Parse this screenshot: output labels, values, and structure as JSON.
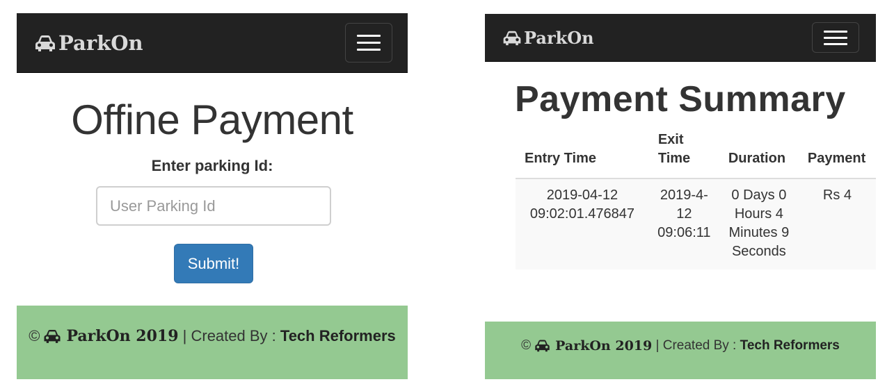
{
  "left": {
    "navbar": {
      "brand": "ParkOn"
    },
    "title": "Offine Payment",
    "form": {
      "label": "Enter parking Id:",
      "input_placeholder": "User Parking Id",
      "input_value": "",
      "submit_label": "Submit!"
    },
    "footer": {
      "copyright": "©",
      "brand": "ParkOn 2019",
      "separator": "| Created By :",
      "author": "Tech Reformers"
    }
  },
  "right": {
    "navbar": {
      "brand": "ParkOn"
    },
    "title": "Payment Summary",
    "table": {
      "headers": [
        "Entry Time",
        "Exit Time",
        "Duration",
        "Payment"
      ],
      "rows": [
        {
          "entry_time": "2019-04-12 09:02:01.476847",
          "exit_time": "2019-4-12 09:06:11",
          "duration": "0 Days 0 Hours 4 Minutes 9 Seconds",
          "payment": "Rs 4"
        }
      ]
    },
    "footer": {
      "copyright": "©",
      "brand": "ParkOn 2019",
      "separator": "| Created By :",
      "author": "Tech Reformers"
    }
  },
  "icons": {
    "brand_icon": "car-icon",
    "menu_icon": "hamburger-menu-icon"
  },
  "colors": {
    "navbar_bg": "#222222",
    "footer_bg": "#94c991",
    "primary_button": "#337ab7"
  }
}
